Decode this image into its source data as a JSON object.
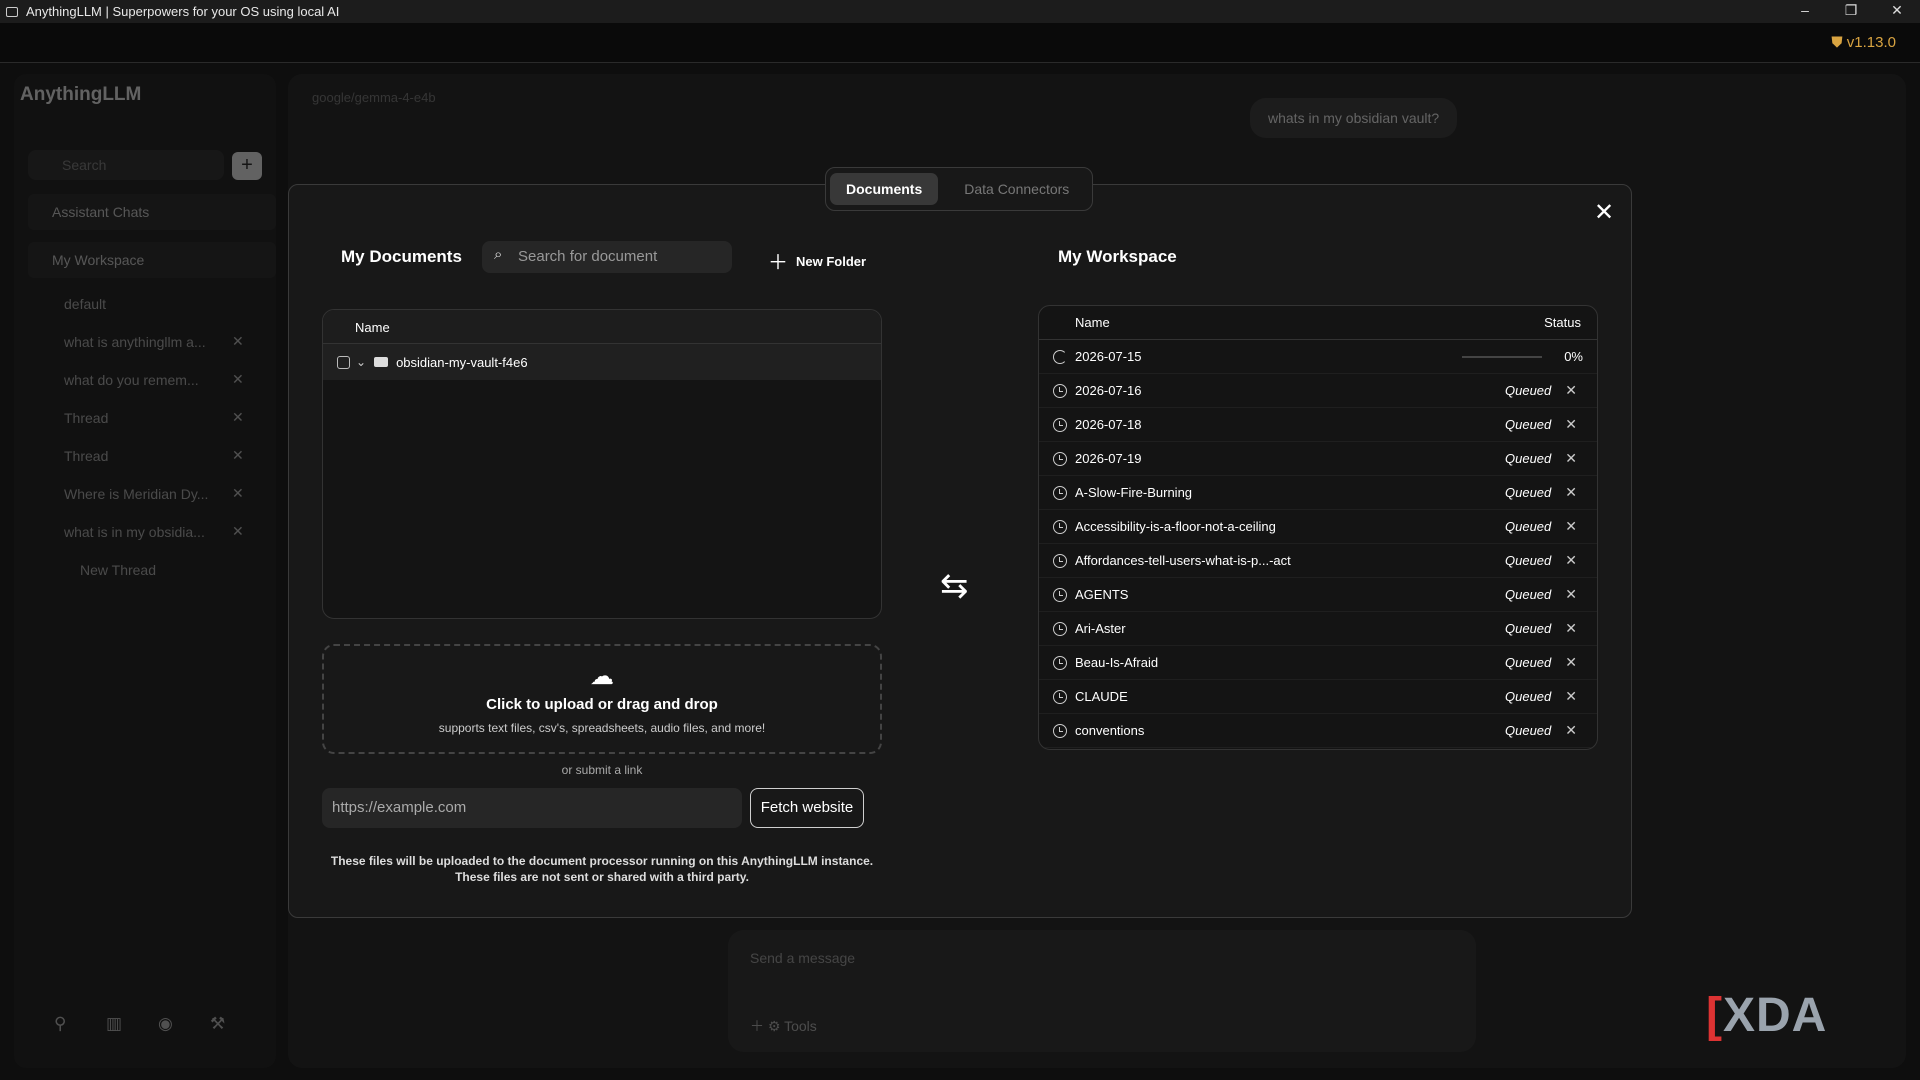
{
  "window": {
    "title": "AnythingLLM | Superpowers for your OS using local AI",
    "minimize": "–",
    "restore": "❐",
    "close": "✕"
  },
  "topbar": {
    "version": "v1.13.0"
  },
  "sidebar": {
    "logo": "AnythingLLM",
    "search_placeholder": "Search",
    "add": "+",
    "assistant_chats": "Assistant Chats",
    "workspace": "My Workspace",
    "threads": [
      {
        "label": "default"
      },
      {
        "label": "what is anythingllm a..."
      },
      {
        "label": "what do you remem..."
      },
      {
        "label": "Thread"
      },
      {
        "label": "Thread"
      },
      {
        "label": "Where is Meridian Dy..."
      },
      {
        "label": "what is in my obsidia..."
      }
    ],
    "new_thread": "New Thread"
  },
  "chat": {
    "model": "google/gemma-4-e4b",
    "user_message": "whats in my obsidian vault?",
    "composer_placeholder": "Send a message",
    "tools_label": "Tools"
  },
  "modal": {
    "tabs": [
      "Documents",
      "Data Connectors"
    ],
    "close": "✕",
    "my_documents": {
      "title": "My Documents",
      "search_placeholder": "Search for document",
      "new_folder": "New Folder",
      "column_name": "Name",
      "folder": "obsidian-my-vault-f4e6"
    },
    "upload": {
      "main": "Click to upload or drag and drop",
      "sub": "supports text files, csv's, spreadsheets, audio files, and more!",
      "or_link": "or submit a link",
      "url_placeholder": "https://example.com",
      "fetch_button": "Fetch website",
      "notice_1": "These files will be uploaded to the document processor running on this AnythingLLM instance.",
      "notice_2": "These files are not sent or shared with a third party."
    },
    "workspace": {
      "title": "My Workspace",
      "column_name": "Name",
      "column_status": "Status",
      "processing": {
        "name": "2026-07-15",
        "progress": "0%"
      },
      "queued_label": "Queued",
      "items": [
        "2026-07-16",
        "2026-07-18",
        "2026-07-19",
        "A-Slow-Fire-Burning",
        "Accessibility-is-a-floor-not-a-ceiling",
        "Affordances-tell-users-what-is-p...-act",
        "AGENTS",
        "Ari-Aster",
        "Beau-Is-Afraid",
        "CLAUDE",
        "conventions"
      ]
    }
  },
  "watermark": "XDA"
}
